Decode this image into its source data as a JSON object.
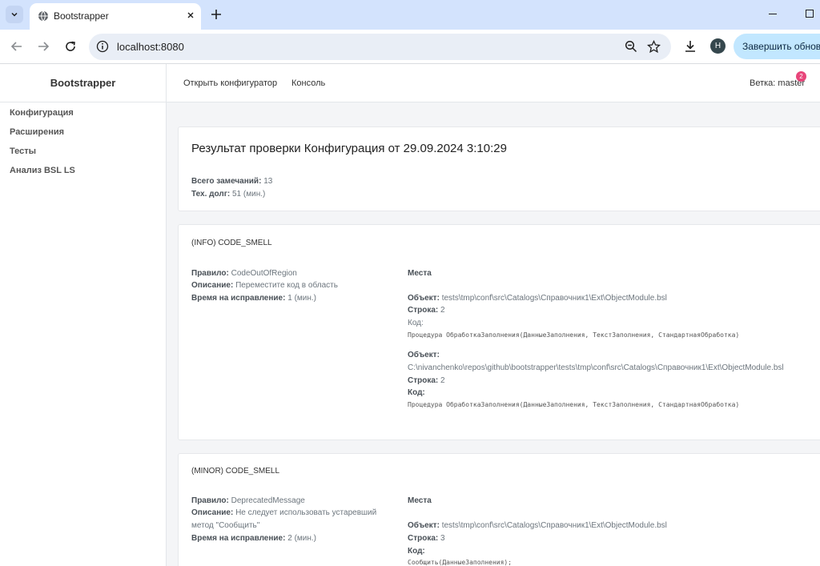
{
  "browser": {
    "tab_title": "Bootstrapper",
    "url": "localhost:8080",
    "profile_initial": "H",
    "update_button": "Завершить обновление"
  },
  "sidebar": {
    "brand": "Bootstrapper",
    "items": [
      {
        "label": "Конфигурация"
      },
      {
        "label": "Расширения"
      },
      {
        "label": "Тесты"
      },
      {
        "label": "Анализ BSL LS"
      }
    ]
  },
  "topnav": {
    "open_configurator": "Открыть конфигуратор",
    "console": "Консоль",
    "branch": "Ветка: master",
    "badge": "2"
  },
  "summary": {
    "title": "Результат проверки Конфигурация от 29.09.2024 3:10:29",
    "total_label": "Всего замечаний:",
    "total_value": "13",
    "debt_label": "Тех. долг:",
    "debt_value": "51 (мин.)"
  },
  "labels": {
    "rule": "Правило:",
    "description": "Описание:",
    "fix_time": "Время на исправление:",
    "places": "Места",
    "object": "Объект:",
    "line": "Строка:",
    "code": "Код:"
  },
  "issues": [
    {
      "title": "(INFO) CODE_SMELL",
      "rule": "CodeOutOfRegion",
      "description": "Переместите код в область",
      "fix_time": "1 (мин.)",
      "places": [
        {
          "object": "tests\\tmp\\conf\\src\\Catalogs\\Справочник1\\Ext\\ObjectModule.bsl",
          "line": "2",
          "code": "Процедура ОбработкаЗаполнения(ДанныеЗаполнения, ТекстЗаполнения, СтандартнаяОбработка)"
        },
        {
          "object": "C:\\nivanchenko\\repos\\github\\bootstrapper\\tests\\tmp\\conf\\src\\Catalogs\\Справочник1\\Ext\\ObjectModule.bsl",
          "line": "2",
          "code": "Процедура ОбработкаЗаполнения(ДанныеЗаполнения, ТекстЗаполнения, СтандартнаяОбработка)"
        }
      ]
    },
    {
      "title": "(MINOR) CODE_SMELL",
      "rule": "DeprecatedMessage",
      "description_line1": "Не следует использовать устаревший",
      "description_line2": "метод \"Сообщить\"",
      "fix_time": "2 (мин.)",
      "places": [
        {
          "object": "tests\\tmp\\conf\\src\\Catalogs\\Справочник1\\Ext\\ObjectModule.bsl",
          "line": "3",
          "code": "Сообщить(ДанныеЗаполнения);"
        }
      ]
    }
  ]
}
